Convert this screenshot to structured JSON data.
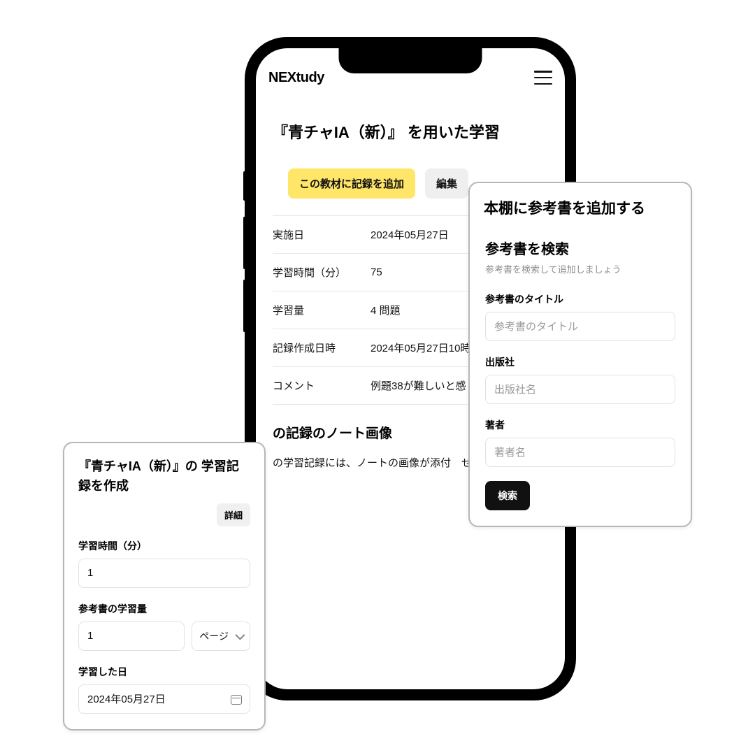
{
  "brand": "NEXtudy",
  "page": {
    "title": "『青チャIA（新）』 を用いた学習",
    "add_record_label": "この教材に記録を追加",
    "edit_label": "編集",
    "details": {
      "date_label": "実施日",
      "date_value": "2024年05月27日",
      "duration_label": "学習時間（分）",
      "duration_value": "75",
      "amount_label": "学習量",
      "amount_value": "4 問題",
      "created_label": "記録作成日時",
      "created_value": "2024年05月27日10時",
      "comment_label": "コメント",
      "comment_value": "例題38が難しいと感"
    },
    "note_image_heading": "の記録のノート画像",
    "note_image_text": "の学習記録には、ノートの画像が添付　せん。"
  },
  "right_card": {
    "heading": "本棚に参考書を追加する",
    "search_title": "参考書を検索",
    "search_sub": "参考書を検索して追加しましょう",
    "title_label": "参考書のタイトル",
    "title_placeholder": "参考書のタイトル",
    "publisher_label": "出版社",
    "publisher_placeholder": "出版社名",
    "author_label": "著者",
    "author_placeholder": "著者名",
    "submit_label": "検索"
  },
  "left_card": {
    "heading": "『青チャIA（新）』の 学習記録を作成",
    "detail_label": "詳細",
    "duration_label": "学習時間（分）",
    "duration_value": "1",
    "amount_label": "参考書の学習量",
    "amount_value": "1",
    "unit_label": "ページ",
    "date_label": "学習した日",
    "date_value": "2024年05月27日"
  }
}
